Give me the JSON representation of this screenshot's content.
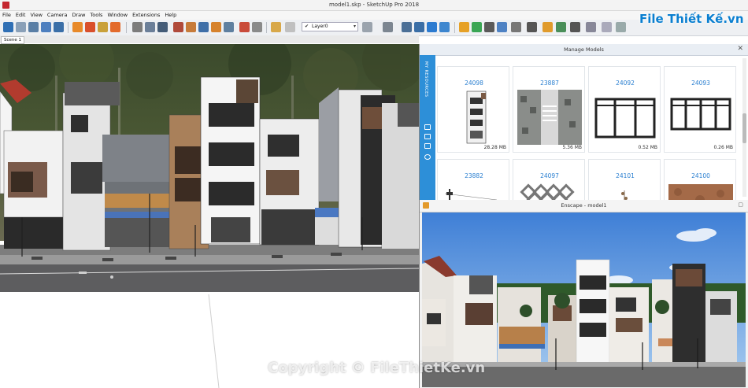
{
  "window": {
    "title": "model1.skp - SketchUp Pro 2018"
  },
  "menu": [
    "File",
    "Edit",
    "View",
    "Camera",
    "Draw",
    "Tools",
    "Window",
    "Extensions",
    "Help"
  ],
  "toolbar": {
    "layer_value": "Layer0",
    "layer_check": "✔"
  },
  "scene_tabs": [
    "Scene 1"
  ],
  "manage_models": {
    "title": "Manage Models",
    "close": "✕",
    "side_label": "MY RESOURCES",
    "cards": [
      {
        "id": "24098",
        "size": "28.28 MB"
      },
      {
        "id": "23887",
        "size": "5.36 MB"
      },
      {
        "id": "24092",
        "size": "0.52 MB"
      },
      {
        "id": "24093",
        "size": "0.26 MB"
      },
      {
        "id": "23882",
        "size": ""
      },
      {
        "id": "24097",
        "size": ""
      },
      {
        "id": "24101",
        "size": ""
      },
      {
        "id": "24100",
        "size": ""
      }
    ]
  },
  "enscape": {
    "title": "Enscape - model1",
    "close": "▢"
  },
  "watermark": {
    "text": "Copyright © FileThietKe.vn"
  },
  "brand": {
    "text": "File Thiết Kế.vn"
  },
  "colors": {
    "accent": "#2d8fd8",
    "card_id": "#2a7fd0",
    "brand": "#0a7fd0"
  }
}
